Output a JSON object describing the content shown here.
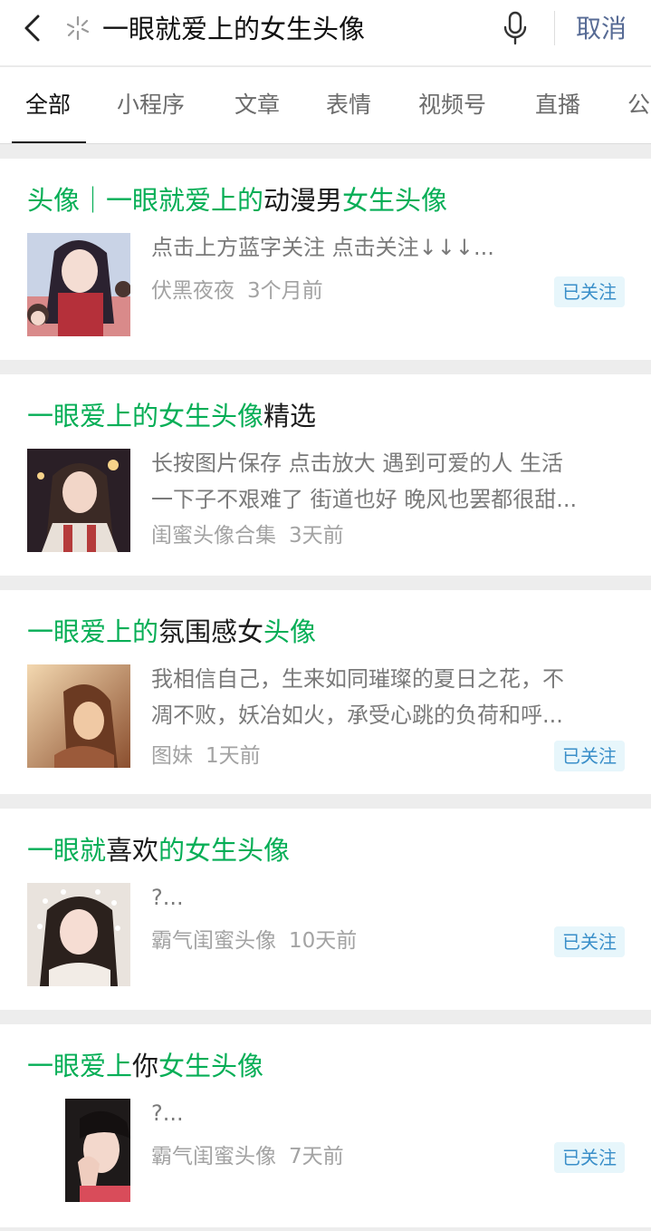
{
  "search": {
    "query": "一眼就爱上的女生头像",
    "cancel_label": "取消"
  },
  "tabs": [
    {
      "label": "全部"
    },
    {
      "label": "小程序"
    },
    {
      "label": "文章"
    },
    {
      "label": "表情"
    },
    {
      "label": "视频号"
    },
    {
      "label": "直播"
    },
    {
      "label": "公"
    }
  ],
  "results": [
    {
      "title_parts": [
        "头像｜一眼就爱上的",
        "动漫男",
        "女生头像"
      ],
      "desc_lines": [
        "点击上方蓝字关注 点击关注↓↓↓..."
      ],
      "source": "伏黑夜夜",
      "time": "3个月前",
      "badge": "已关注"
    },
    {
      "title_parts": [
        "一眼爱上的女生头像",
        "精选"
      ],
      "desc_lines": [
        "长按图片保存 点击放大 遇到可爱的人 生活",
        "一下子不艰难了 街道也好 晚风也罢都很甜..."
      ],
      "source": "闺蜜头像合集",
      "time": "3天前"
    },
    {
      "title_parts": [
        "一眼爱上的",
        "氛围感女",
        "头像"
      ],
      "desc_lines": [
        "我相信自己，生来如同璀璨的夏日之花，不",
        "凋不败，妖冶如火，承受心跳的负荷和呼..."
      ],
      "source": "图妹",
      "time": "1天前",
      "badge": "已关注"
    },
    {
      "title_parts": [
        "一眼就",
        "喜欢",
        "的女生头像"
      ],
      "desc_lines": [
        "?..."
      ],
      "source": "霸气闺蜜头像",
      "time": "10天前",
      "badge": "已关注"
    },
    {
      "title_parts": [
        "一眼爱上",
        "你",
        "女生头像"
      ],
      "desc_lines": [
        "?..."
      ],
      "source": "霸气闺蜜头像",
      "time": "7天前",
      "badge": "已关注"
    }
  ],
  "icons": {
    "back": "chevron-left-icon",
    "star": "sparkle-icon",
    "mic": "microphone-icon"
  },
  "colors": {
    "highlight": "#06ae56",
    "cancel": "#576b95",
    "badge_bg": "#e7f6fb",
    "badge_text": "#3a8fc9"
  }
}
